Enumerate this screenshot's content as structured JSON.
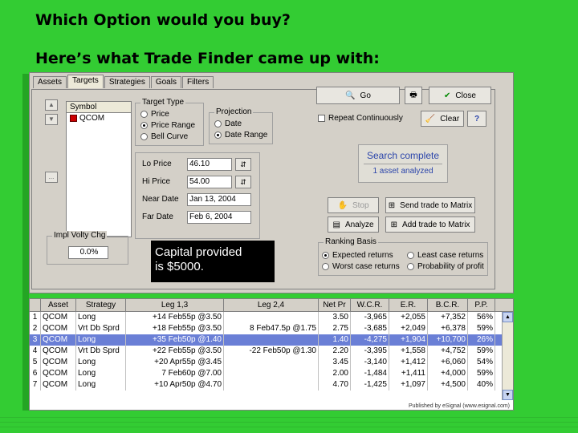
{
  "slide": {
    "title": "Which Option would you buy?",
    "subtitle": "Here’s what Trade Finder came up with:"
  },
  "tabs": [
    "Assets",
    "Targets",
    "Strategies",
    "Goals",
    "Filters"
  ],
  "symbol": {
    "header": "Symbol",
    "items": [
      "QCOM"
    ],
    "more_button": "..."
  },
  "target_type": {
    "label": "Target Type",
    "options": [
      "Price",
      "Price Range",
      "Bell Curve"
    ],
    "selected": "Price Range"
  },
  "projection": {
    "label": "Projection",
    "options": [
      "Date",
      "Date Range"
    ],
    "selected": "Date Range"
  },
  "fields": {
    "lo_price_label": "Lo Price",
    "lo_price_value": "46.10",
    "hi_price_label": "Hi Price",
    "hi_price_value": "54.00",
    "near_date_label": "Near Date",
    "near_date_value": "Jan 13, 2004",
    "far_date_label": "Far Date",
    "far_date_value": "Feb 6, 2004"
  },
  "impl_volty": {
    "label": "Impl Volty Chg",
    "value": "0.0%"
  },
  "buttons": {
    "go": "Go",
    "close": "Close",
    "repeat": "Repeat Continuously",
    "clear": "Clear",
    "help": "?",
    "stop": "Stop",
    "send_matrix": "Send trade to Matrix",
    "analyze": "Analyze",
    "add_matrix": "Add trade to Matrix"
  },
  "status": {
    "title": "Search complete",
    "subtitle": "1 asset analyzed"
  },
  "ranking": {
    "label": "Ranking Basis",
    "options": [
      "Expected returns",
      "Least case returns",
      "Worst case returns",
      "Probability of profit"
    ],
    "selected": "Expected returns"
  },
  "callout": {
    "line1": "Capital provided",
    "line2": "is $5000."
  },
  "results": {
    "columns": [
      "",
      "Asset",
      "Strategy",
      "Leg 1,3",
      "Leg 2,4",
      "Net Pr",
      "W.C.R.",
      "E.R.",
      "B.C.R.",
      "P.P."
    ],
    "rows": [
      [
        "1",
        "QCOM",
        "Long",
        "+14 Feb55p @3.50",
        "",
        "3.50",
        "-3,965",
        "+2,055",
        "+7,352",
        "56%"
      ],
      [
        "2",
        "QCOM",
        "Vrt Db Sprd",
        "+18 Feb55p @3.50",
        "8 Feb47.5p @1.75",
        "2.75",
        "-3,685",
        "+2,049",
        "+6,378",
        "59%"
      ],
      [
        "3",
        "QCOM",
        "Long",
        "+35 Feb50p @1.40",
        "",
        "1.40",
        "-4,275",
        "+1,904",
        "+10,700",
        "26%"
      ],
      [
        "4",
        "QCOM",
        "Vrt Db Sprd",
        "+22 Feb55p @3.50",
        "-22 Feb50p @1.30",
        "2.20",
        "-3,395",
        "+1,558",
        "+4,752",
        "59%"
      ],
      [
        "5",
        "QCOM",
        "Long",
        "+20 Apr55p @3.45",
        "",
        "3.45",
        "-3,140",
        "+1,412",
        "+6,060",
        "54%"
      ],
      [
        "6",
        "QCOM",
        "Long",
        "7 Feb60p @7.00",
        "",
        "2.00",
        "-1,484",
        "+1,411",
        "+4,000",
        "59%"
      ],
      [
        "7",
        "QCOM",
        "Long",
        "+10 Apr50p @4.70",
        "",
        "4.70",
        "-1,425",
        "+1,097",
        "+4,500",
        "40%"
      ]
    ],
    "selected_row": 2,
    "footer": "Published by eSignal (www.esignal.com)"
  },
  "colors": {
    "background": "#33cc33",
    "selection": "#6a7fd6",
    "status_text": "#2a44aa"
  }
}
